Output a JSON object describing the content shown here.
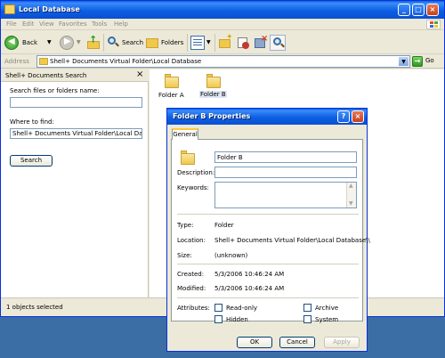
{
  "window": {
    "title": "Local Database",
    "menu": [
      "File",
      "Edit",
      "View",
      "Favorites",
      "Tools",
      "Help"
    ],
    "toolbar": {
      "back": "Back",
      "search": "Search",
      "folders": "Folders"
    },
    "address": {
      "label": "Address",
      "value": "Shell+ Documents Virtual Folder\\Local Database",
      "go": "Go"
    },
    "search_pane": {
      "title": "Shell+ Documents Search",
      "close": "×",
      "name_label": "Search files or folders name:",
      "name_value": "",
      "where_label": "Where to find:",
      "where_value": "Shell+ Documents Virtual Folder\\Local Database\\",
      "search_button": "Search"
    },
    "items": [
      {
        "name": "Folder A"
      },
      {
        "name": "Folder B"
      }
    ],
    "status": "1 objects selected"
  },
  "dialog": {
    "title": "Folder B Properties",
    "help": "?",
    "close": "×",
    "tab": "General",
    "name_value": "Folder B",
    "description_label": "Description:",
    "description_value": "",
    "keywords_label": "Keywords:",
    "keywords_value": "",
    "type_label": "Type:",
    "type_value": "Folder",
    "location_label": "Location:",
    "location_value": "Shell+ Documents Virtual Folder\\Local Database\\\\",
    "size_label": "Size:",
    "size_value": "(unknown)",
    "created_label": "Created:",
    "created_value": "5/3/2006 10:46:24 AM",
    "modified_label": "Modified:",
    "modified_value": "5/3/2006 10:46:24 AM",
    "attributes_label": "Attributes:",
    "attributes": {
      "readonly": {
        "label": "Read-only",
        "checked": false
      },
      "archive": {
        "label": "Archive",
        "checked": false
      },
      "hidden": {
        "label": "Hidden",
        "checked": false
      },
      "system": {
        "label": "System",
        "checked": false
      }
    },
    "buttons": {
      "ok": "OK",
      "cancel": "Cancel",
      "apply": "Apply"
    }
  }
}
